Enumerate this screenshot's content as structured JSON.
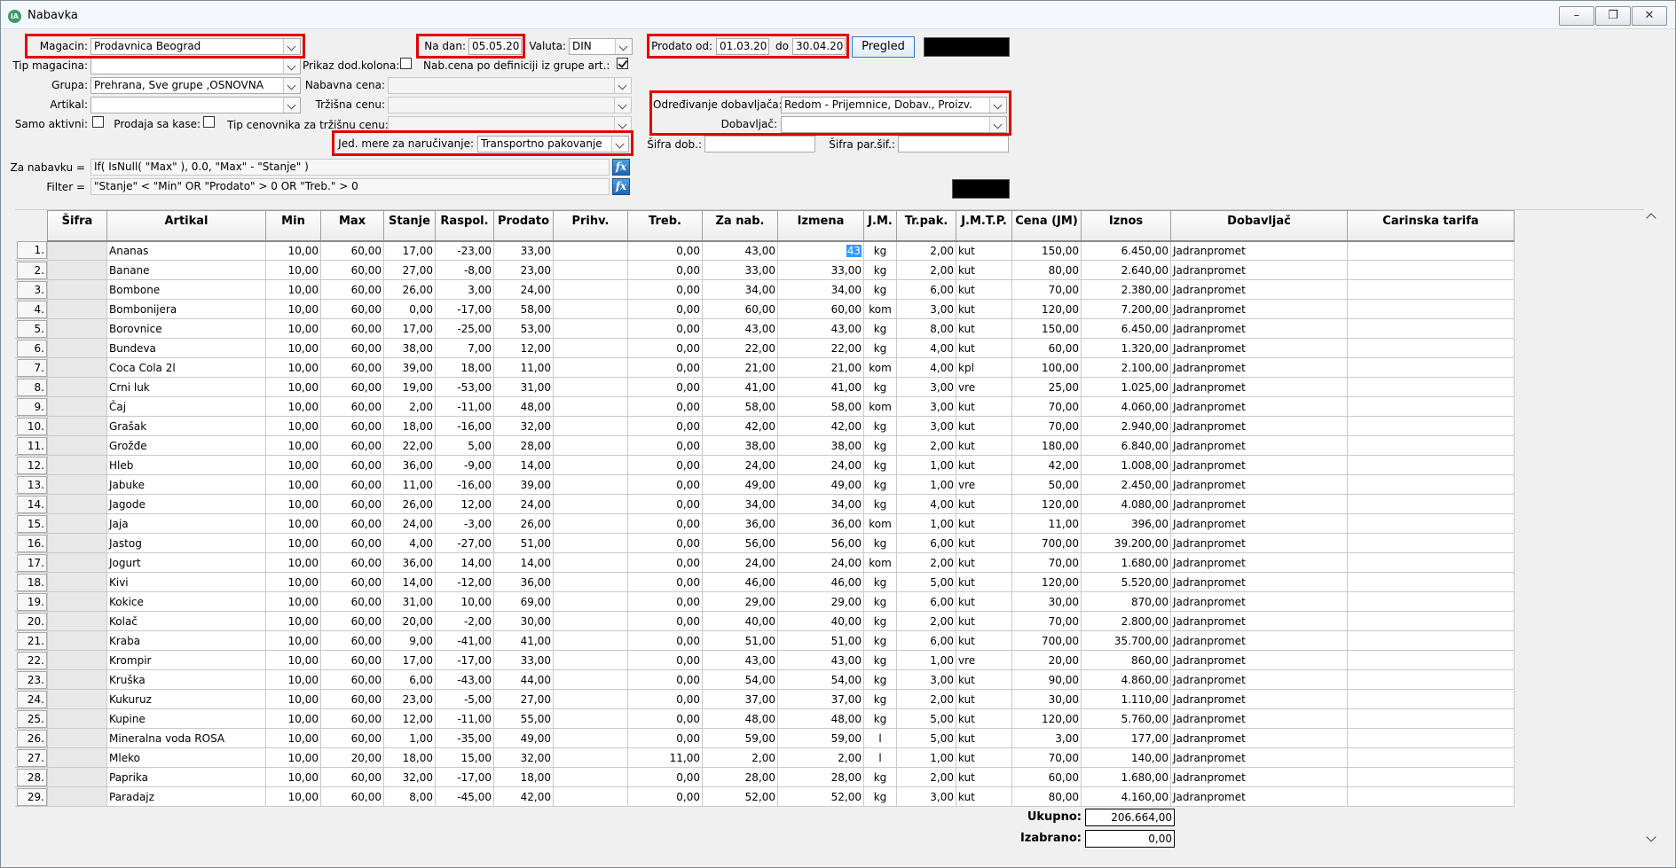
{
  "window": {
    "title": "Nabavka"
  },
  "filters": {
    "magacin_label": "Magacin:",
    "magacin_value": "Prodavnica Beograd",
    "tip_magacina_label": "Tip magacina:",
    "tip_magacina_value": "",
    "grupa_label": "Grupa:",
    "grupa_value": "Prehrana, Sve grupe ,OSNOVNA",
    "artikal_label": "Artikal:",
    "artikal_value": "",
    "samo_aktivni_label": "Samo aktivni:",
    "prodaja_sa_kase_label": "Prodaja sa kase:",
    "tip_cenovnika_label": "Tip cenovnika za tržišnu cenu:",
    "na_dan_label": "Na dan:",
    "na_dan_value": "05.05.20",
    "valuta_label": "Valuta:",
    "valuta_value": "DIN",
    "prikaz_dod_label": "Prikaz dod.kolona:",
    "nab_cena_def_label": "Nab.cena po definiciji iz grupe art.:",
    "nabavna_cena_label": "Nabavna cena:",
    "trzisna_cena_label": "Tržišna cenu:",
    "jed_mere_label": "Jed. mere za naručivanje:",
    "jed_mere_value": "Transportno pakovanje",
    "prodato_od_label": "Prodato od:",
    "prodato_od_value": "01.03.20",
    "do_label": "do",
    "do_value": "30.04.20",
    "pregled_label": "Pregled",
    "odredjivanje_label": "Određivanje dobavljača:",
    "odredjivanje_value": "Redom - Prijemnice, Dobav., Proizv.",
    "dobavljac_label": "Dobavljač:",
    "dobavljac_value": "",
    "sifra_dob_label": "Šifra dob.:",
    "sifra_par_label": "Šifra par.šif.:",
    "za_nabavku_label": "Za nabavku =",
    "za_nabavku_value": "If( IsNull( \"Max\" ), 0.0, \"Max\" - \"Stanje\" )",
    "filter_label": "Filter =",
    "filter_value": "\"Stanje\"  <  \"Min\" OR \"Prodato\" > 0 OR \"Treb.\" > 0",
    "fx_label": "fx"
  },
  "grid": {
    "columns": [
      "Šifra",
      "Artikal",
      "Min",
      "Max",
      "Stanje",
      "Raspol.",
      "Prodato",
      "Prihv.",
      "Treb.",
      "Za nab.",
      "Izmena",
      "J.M.",
      "Tr.pak.",
      "J.M.T.P.",
      "Cena (JM)",
      "Iznos",
      "Dobavljač",
      "Carinska tarifa"
    ],
    "rows": [
      {
        "n": "1.",
        "artikal": "Ananas",
        "min": "10,00",
        "max": "60,00",
        "stanje": "17,00",
        "raspol": "-23,00",
        "prodato": "33,00",
        "prihv": "",
        "treb": "0,00",
        "zanab": "43,00",
        "izmena": "43",
        "jm": "kg",
        "trpak": "2,00",
        "jmtp": "kut",
        "cena": "150,00",
        "iznos": "6.450,00",
        "dob": "Jadranpromet"
      },
      {
        "n": "2.",
        "artikal": "Banane",
        "min": "10,00",
        "max": "60,00",
        "stanje": "27,00",
        "raspol": "-8,00",
        "prodato": "23,00",
        "prihv": "",
        "treb": "0,00",
        "zanab": "33,00",
        "izmena": "33,00",
        "jm": "kg",
        "trpak": "2,00",
        "jmtp": "kut",
        "cena": "80,00",
        "iznos": "2.640,00",
        "dob": "Jadranpromet"
      },
      {
        "n": "3.",
        "artikal": "Bombone",
        "min": "10,00",
        "max": "60,00",
        "stanje": "26,00",
        "raspol": "3,00",
        "prodato": "24,00",
        "prihv": "",
        "treb": "0,00",
        "zanab": "34,00",
        "izmena": "34,00",
        "jm": "kg",
        "trpak": "6,00",
        "jmtp": "kut",
        "cena": "70,00",
        "iznos": "2.380,00",
        "dob": "Jadranpromet"
      },
      {
        "n": "4.",
        "artikal": "Bombonijera",
        "min": "10,00",
        "max": "60,00",
        "stanje": "0,00",
        "raspol": "-17,00",
        "prodato": "58,00",
        "prihv": "",
        "treb": "0,00",
        "zanab": "60,00",
        "izmena": "60,00",
        "jm": "kom",
        "trpak": "3,00",
        "jmtp": "kut",
        "cena": "120,00",
        "iznos": "7.200,00",
        "dob": "Jadranpromet"
      },
      {
        "n": "5.",
        "artikal": "Borovnice",
        "min": "10,00",
        "max": "60,00",
        "stanje": "17,00",
        "raspol": "-25,00",
        "prodato": "53,00",
        "prihv": "",
        "treb": "0,00",
        "zanab": "43,00",
        "izmena": "43,00",
        "jm": "kg",
        "trpak": "8,00",
        "jmtp": "kut",
        "cena": "150,00",
        "iznos": "6.450,00",
        "dob": "Jadranpromet"
      },
      {
        "n": "6.",
        "artikal": "Bundeva",
        "min": "10,00",
        "max": "60,00",
        "stanje": "38,00",
        "raspol": "7,00",
        "prodato": "12,00",
        "prihv": "",
        "treb": "0,00",
        "zanab": "22,00",
        "izmena": "22,00",
        "jm": "kg",
        "trpak": "4,00",
        "jmtp": "kut",
        "cena": "60,00",
        "iznos": "1.320,00",
        "dob": "Jadranpromet"
      },
      {
        "n": "7.",
        "artikal": "Coca Cola 2l",
        "min": "10,00",
        "max": "60,00",
        "stanje": "39,00",
        "raspol": "18,00",
        "prodato": "11,00",
        "prihv": "",
        "treb": "0,00",
        "zanab": "21,00",
        "izmena": "21,00",
        "jm": "kom",
        "trpak": "4,00",
        "jmtp": "kpl",
        "cena": "100,00",
        "iznos": "2.100,00",
        "dob": "Jadranpromet"
      },
      {
        "n": "8.",
        "artikal": "Crni luk",
        "min": "10,00",
        "max": "60,00",
        "stanje": "19,00",
        "raspol": "-53,00",
        "prodato": "31,00",
        "prihv": "",
        "treb": "0,00",
        "zanab": "41,00",
        "izmena": "41,00",
        "jm": "kg",
        "trpak": "3,00",
        "jmtp": "vre",
        "cena": "25,00",
        "iznos": "1.025,00",
        "dob": "Jadranpromet"
      },
      {
        "n": "9.",
        "artikal": "Čaj",
        "min": "10,00",
        "max": "60,00",
        "stanje": "2,00",
        "raspol": "-11,00",
        "prodato": "48,00",
        "prihv": "",
        "treb": "0,00",
        "zanab": "58,00",
        "izmena": "58,00",
        "jm": "kom",
        "trpak": "3,00",
        "jmtp": "kut",
        "cena": "70,00",
        "iznos": "4.060,00",
        "dob": "Jadranpromet"
      },
      {
        "n": "10.",
        "artikal": "Grašak",
        "min": "10,00",
        "max": "60,00",
        "stanje": "18,00",
        "raspol": "-16,00",
        "prodato": "32,00",
        "prihv": "",
        "treb": "0,00",
        "zanab": "42,00",
        "izmena": "42,00",
        "jm": "kg",
        "trpak": "3,00",
        "jmtp": "kut",
        "cena": "70,00",
        "iznos": "2.940,00",
        "dob": "Jadranpromet"
      },
      {
        "n": "11.",
        "artikal": "Grožđe",
        "min": "10,00",
        "max": "60,00",
        "stanje": "22,00",
        "raspol": "5,00",
        "prodato": "28,00",
        "prihv": "",
        "treb": "0,00",
        "zanab": "38,00",
        "izmena": "38,00",
        "jm": "kg",
        "trpak": "2,00",
        "jmtp": "kut",
        "cena": "180,00",
        "iznos": "6.840,00",
        "dob": "Jadranpromet"
      },
      {
        "n": "12.",
        "artikal": "Hleb",
        "min": "10,00",
        "max": "60,00",
        "stanje": "36,00",
        "raspol": "-9,00",
        "prodato": "14,00",
        "prihv": "",
        "treb": "0,00",
        "zanab": "24,00",
        "izmena": "24,00",
        "jm": "kg",
        "trpak": "1,00",
        "jmtp": "kut",
        "cena": "42,00",
        "iznos": "1.008,00",
        "dob": "Jadranpromet"
      },
      {
        "n": "13.",
        "artikal": "Jabuke",
        "min": "10,00",
        "max": "60,00",
        "stanje": "11,00",
        "raspol": "-16,00",
        "prodato": "39,00",
        "prihv": "",
        "treb": "0,00",
        "zanab": "49,00",
        "izmena": "49,00",
        "jm": "kg",
        "trpak": "1,00",
        "jmtp": "vre",
        "cena": "50,00",
        "iznos": "2.450,00",
        "dob": "Jadranpromet"
      },
      {
        "n": "14.",
        "artikal": "Jagode",
        "min": "10,00",
        "max": "60,00",
        "stanje": "26,00",
        "raspol": "12,00",
        "prodato": "24,00",
        "prihv": "",
        "treb": "0,00",
        "zanab": "34,00",
        "izmena": "34,00",
        "jm": "kg",
        "trpak": "4,00",
        "jmtp": "kut",
        "cena": "120,00",
        "iznos": "4.080,00",
        "dob": "Jadranpromet"
      },
      {
        "n": "15.",
        "artikal": "Jaja",
        "min": "10,00",
        "max": "60,00",
        "stanje": "24,00",
        "raspol": "-3,00",
        "prodato": "26,00",
        "prihv": "",
        "treb": "0,00",
        "zanab": "36,00",
        "izmena": "36,00",
        "jm": "kom",
        "trpak": "1,00",
        "jmtp": "kut",
        "cena": "11,00",
        "iznos": "396,00",
        "dob": "Jadranpromet"
      },
      {
        "n": "16.",
        "artikal": "Jastog",
        "min": "10,00",
        "max": "60,00",
        "stanje": "4,00",
        "raspol": "-27,00",
        "prodato": "51,00",
        "prihv": "",
        "treb": "0,00",
        "zanab": "56,00",
        "izmena": "56,00",
        "jm": "kg",
        "trpak": "6,00",
        "jmtp": "kut",
        "cena": "700,00",
        "iznos": "39.200,00",
        "dob": "Jadranpromet"
      },
      {
        "n": "17.",
        "artikal": "Jogurt",
        "min": "10,00",
        "max": "60,00",
        "stanje": "36,00",
        "raspol": "14,00",
        "prodato": "14,00",
        "prihv": "",
        "treb": "0,00",
        "zanab": "24,00",
        "izmena": "24,00",
        "jm": "kom",
        "trpak": "2,00",
        "jmtp": "kut",
        "cena": "70,00",
        "iznos": "1.680,00",
        "dob": "Jadranpromet"
      },
      {
        "n": "18.",
        "artikal": "Kivi",
        "min": "10,00",
        "max": "60,00",
        "stanje": "14,00",
        "raspol": "-12,00",
        "prodato": "36,00",
        "prihv": "",
        "treb": "0,00",
        "zanab": "46,00",
        "izmena": "46,00",
        "jm": "kg",
        "trpak": "5,00",
        "jmtp": "kut",
        "cena": "120,00",
        "iznos": "5.520,00",
        "dob": "Jadranpromet"
      },
      {
        "n": "19.",
        "artikal": "Kokice",
        "min": "10,00",
        "max": "60,00",
        "stanje": "31,00",
        "raspol": "10,00",
        "prodato": "69,00",
        "prihv": "",
        "treb": "0,00",
        "zanab": "29,00",
        "izmena": "29,00",
        "jm": "kg",
        "trpak": "6,00",
        "jmtp": "kut",
        "cena": "30,00",
        "iznos": "870,00",
        "dob": "Jadranpromet"
      },
      {
        "n": "20.",
        "artikal": "Kolač",
        "min": "10,00",
        "max": "60,00",
        "stanje": "20,00",
        "raspol": "-2,00",
        "prodato": "30,00",
        "prihv": "",
        "treb": "0,00",
        "zanab": "40,00",
        "izmena": "40,00",
        "jm": "kg",
        "trpak": "2,00",
        "jmtp": "kut",
        "cena": "70,00",
        "iznos": "2.800,00",
        "dob": "Jadranpromet"
      },
      {
        "n": "21.",
        "artikal": "Kraba",
        "min": "10,00",
        "max": "60,00",
        "stanje": "9,00",
        "raspol": "-41,00",
        "prodato": "41,00",
        "prihv": "",
        "treb": "0,00",
        "zanab": "51,00",
        "izmena": "51,00",
        "jm": "kg",
        "trpak": "6,00",
        "jmtp": "kut",
        "cena": "700,00",
        "iznos": "35.700,00",
        "dob": "Jadranpromet"
      },
      {
        "n": "22.",
        "artikal": "Krompir",
        "min": "10,00",
        "max": "60,00",
        "stanje": "17,00",
        "raspol": "-17,00",
        "prodato": "33,00",
        "prihv": "",
        "treb": "0,00",
        "zanab": "43,00",
        "izmena": "43,00",
        "jm": "kg",
        "trpak": "1,00",
        "jmtp": "vre",
        "cena": "20,00",
        "iznos": "860,00",
        "dob": "Jadranpromet"
      },
      {
        "n": "23.",
        "artikal": "Kruška",
        "min": "10,00",
        "max": "60,00",
        "stanje": "6,00",
        "raspol": "-43,00",
        "prodato": "44,00",
        "prihv": "",
        "treb": "0,00",
        "zanab": "54,00",
        "izmena": "54,00",
        "jm": "kg",
        "trpak": "3,00",
        "jmtp": "kut",
        "cena": "90,00",
        "iznos": "4.860,00",
        "dob": "Jadranpromet"
      },
      {
        "n": "24.",
        "artikal": "Kukuruz",
        "min": "10,00",
        "max": "60,00",
        "stanje": "23,00",
        "raspol": "-5,00",
        "prodato": "27,00",
        "prihv": "",
        "treb": "0,00",
        "zanab": "37,00",
        "izmena": "37,00",
        "jm": "kg",
        "trpak": "2,00",
        "jmtp": "kut",
        "cena": "30,00",
        "iznos": "1.110,00",
        "dob": "Jadranpromet"
      },
      {
        "n": "25.",
        "artikal": "Kupine",
        "min": "10,00",
        "max": "60,00",
        "stanje": "12,00",
        "raspol": "-11,00",
        "prodato": "55,00",
        "prihv": "",
        "treb": "0,00",
        "zanab": "48,00",
        "izmena": "48,00",
        "jm": "kg",
        "trpak": "5,00",
        "jmtp": "kut",
        "cena": "120,00",
        "iznos": "5.760,00",
        "dob": "Jadranpromet"
      },
      {
        "n": "26.",
        "artikal": "Mineralna voda ROSA",
        "min": "10,00",
        "max": "60,00",
        "stanje": "1,00",
        "raspol": "-35,00",
        "prodato": "49,00",
        "prihv": "",
        "treb": "0,00",
        "zanab": "59,00",
        "izmena": "59,00",
        "jm": "l",
        "trpak": "5,00",
        "jmtp": "kut",
        "cena": "3,00",
        "iznos": "177,00",
        "dob": "Jadranpromet"
      },
      {
        "n": "27.",
        "artikal": "Mleko",
        "min": "10,00",
        "max": "20,00",
        "stanje": "18,00",
        "raspol": "15,00",
        "prodato": "32,00",
        "prihv": "",
        "treb": "11,00",
        "zanab": "2,00",
        "izmena": "2,00",
        "jm": "l",
        "trpak": "1,00",
        "jmtp": "kut",
        "cena": "70,00",
        "iznos": "140,00",
        "dob": "Jadranpromet"
      },
      {
        "n": "28.",
        "artikal": "Paprika",
        "min": "10,00",
        "max": "60,00",
        "stanje": "32,00",
        "raspol": "-17,00",
        "prodato": "18,00",
        "prihv": "",
        "treb": "0,00",
        "zanab": "28,00",
        "izmena": "28,00",
        "jm": "kg",
        "trpak": "2,00",
        "jmtp": "kut",
        "cena": "60,00",
        "iznos": "1.680,00",
        "dob": "Jadranpromet"
      },
      {
        "n": "29.",
        "artikal": "Paradajz",
        "min": "10,00",
        "max": "60,00",
        "stanje": "8,00",
        "raspol": "-45,00",
        "prodato": "42,00",
        "prihv": "",
        "treb": "0,00",
        "zanab": "52,00",
        "izmena": "52,00",
        "jm": "kg",
        "trpak": "3,00",
        "jmtp": "kut",
        "cena": "80,00",
        "iznos": "4.160,00",
        "dob": "Jadranpromet"
      }
    ]
  },
  "totals": {
    "ukupno_label": "Ukupno:",
    "ukupno_value": "206.664,00",
    "izabrano_label": "Izabrano:",
    "izabrano_value": "0,00"
  }
}
